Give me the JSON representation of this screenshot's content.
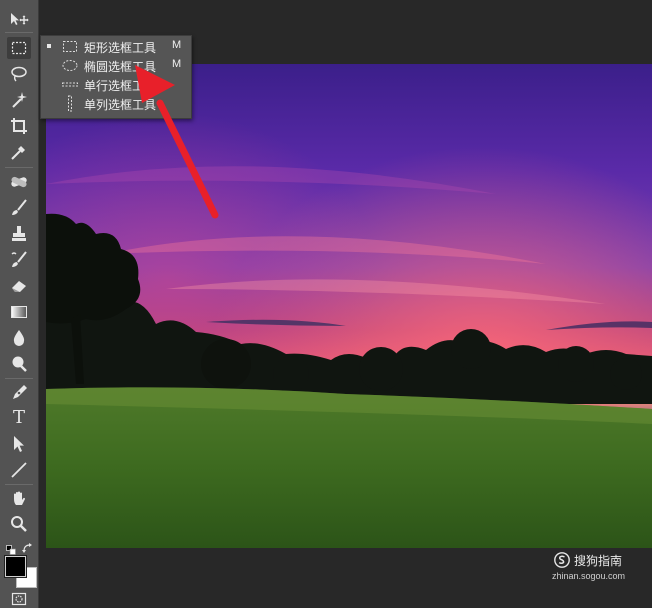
{
  "toolbar": {
    "tools": [
      {
        "name": "move-tool-icon"
      },
      {
        "name": "marquee-tool-icon",
        "active": true
      },
      {
        "name": "lasso-tool-icon"
      },
      {
        "name": "magic-wand-tool-icon"
      },
      {
        "name": "crop-tool-icon"
      },
      {
        "name": "eyedropper-tool-icon"
      },
      {
        "name": "healing-tool-icon"
      },
      {
        "name": "brush-tool-icon"
      },
      {
        "name": "clone-stamp-tool-icon"
      },
      {
        "name": "history-brush-tool-icon"
      },
      {
        "name": "eraser-tool-icon"
      },
      {
        "name": "gradient-tool-icon"
      },
      {
        "name": "blur-tool-icon"
      },
      {
        "name": "dodge-tool-icon"
      },
      {
        "name": "pen-tool-icon"
      },
      {
        "name": "type-tool-icon",
        "glyph": "T"
      },
      {
        "name": "path-selection-tool-icon"
      },
      {
        "name": "line-tool-icon"
      },
      {
        "name": "hand-tool-icon"
      },
      {
        "name": "zoom-tool-icon"
      }
    ],
    "foreground_color": "#000000",
    "background_color": "#ffffff"
  },
  "flyout": {
    "items": [
      {
        "label": "矩形选框工具",
        "shortcut": "M",
        "icon": "rectangular-marquee-icon",
        "selected": true
      },
      {
        "label": "椭圆选框工具",
        "shortcut": "M",
        "icon": "elliptical-marquee-icon",
        "selected": false
      },
      {
        "label": "单行选框工具",
        "shortcut": "",
        "icon": "single-row-marquee-icon",
        "selected": false
      },
      {
        "label": "单列选框工具",
        "shortcut": "",
        "icon": "single-column-marquee-icon",
        "selected": false
      }
    ]
  },
  "annotation": {
    "color": "#e8202a",
    "icon": "red-arrow-icon"
  },
  "watermark": {
    "name": "搜狗指南",
    "url": "zhinan.sogou.com",
    "icon": "sogou-logo-icon"
  },
  "colors": {
    "toolbar_bg": "#535353",
    "canvas_bg": "#282828",
    "menu_bg": "#555555",
    "arrow": "#e8202a"
  }
}
